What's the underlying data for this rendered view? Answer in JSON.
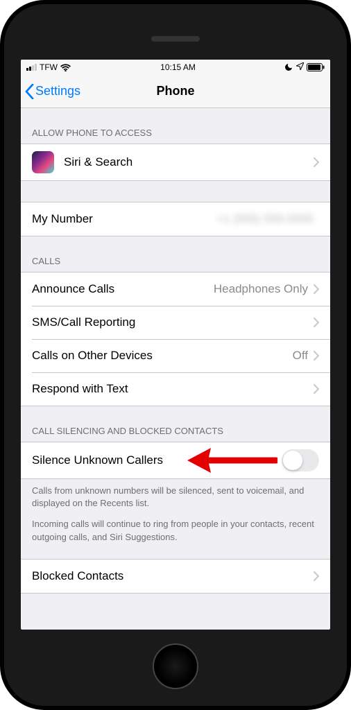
{
  "status_bar": {
    "carrier": "TFW",
    "time": "10:15 AM"
  },
  "nav": {
    "back_label": "Settings",
    "title": "Phone"
  },
  "section_access": {
    "header": "ALLOW PHONE TO ACCESS",
    "siri_label": "Siri & Search"
  },
  "section_mynumber": {
    "label": "My Number",
    "value": "+1 (555) 555-5555"
  },
  "section_calls": {
    "header": "CALLS",
    "announce": {
      "label": "Announce Calls",
      "value": "Headphones Only"
    },
    "sms": {
      "label": "SMS/Call Reporting"
    },
    "other_devices": {
      "label": "Calls on Other Devices",
      "value": "Off"
    },
    "respond": {
      "label": "Respond with Text"
    }
  },
  "section_silencing": {
    "header": "CALL SILENCING AND BLOCKED CONTACTS",
    "silence_label": "Silence Unknown Callers",
    "footer1": "Calls from unknown numbers will be silenced, sent to voicemail, and displayed on the Recents list.",
    "footer2": "Incoming calls will continue to ring from people in your contacts, recent outgoing calls, and Siri Suggestions."
  },
  "section_blocked": {
    "label": "Blocked Contacts"
  }
}
